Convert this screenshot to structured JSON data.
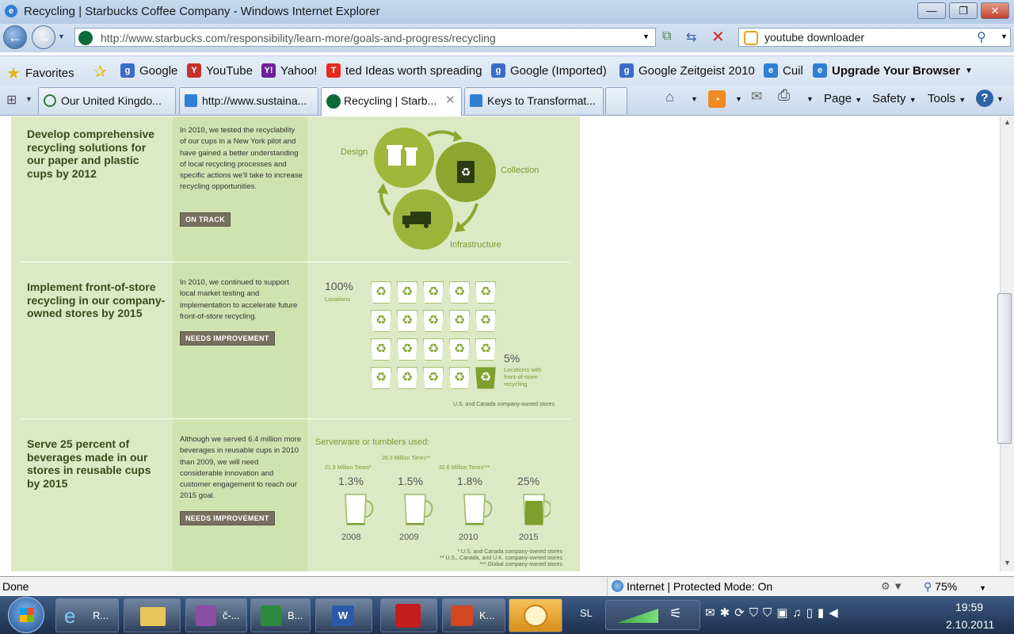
{
  "window": {
    "title": "Recycling | Starbucks Coffee Company - Windows Internet Explorer",
    "controls": {
      "minimize": "—",
      "restore": "❐",
      "close": "✕"
    }
  },
  "nav": {
    "back": "←",
    "forward": "→",
    "url": "http://www.starbucks.com/responsibility/learn-more/goals-and-progress/recycling",
    "search_value": "youtube downloader"
  },
  "favorites": {
    "label": "Favorites",
    "items": [
      "Google",
      "YouTube",
      "Yahoo!",
      "ted Ideas worth spreading",
      "Google (Imported)",
      "Google Zeitgeist 2010",
      "Cuil",
      "Upgrade Your Browser"
    ]
  },
  "tabs": [
    {
      "label": "Our United Kingdo..."
    },
    {
      "label": "http://www.sustaina..."
    },
    {
      "label": "Recycling | Starb..."
    },
    {
      "label": "Keys to Transformat..."
    }
  ],
  "tools": {
    "page": "Page",
    "safety": "Safety",
    "tools": "Tools",
    "help": "?"
  },
  "goals": [
    {
      "title": "Develop comprehensive recycling solutions for our paper and plastic cups by 2012",
      "description": "In 2010, we tested the recyclability of our cups in a New York pilot and have gained a better understanding of local recycling processes and specific actions we'll take to increase recycling opportunities.",
      "status": "ON TRACK"
    },
    {
      "title": "Implement front-of-store recycling in our company-owned stores by 2015",
      "description": "In 2010, we continued to support local market testing and implementation to accelerate future front-of-store recycling.",
      "status": "NEEDS IMPROVEMENT"
    },
    {
      "title": "Serve 25 percent of beverages made in our stores in reusable cups by 2015",
      "description": "Although we served 6.4 million more beverages in reusable cups in 2010 than 2009, we will need considerable innovation and customer engagement to reach our 2015 goal.",
      "status": "NEEDS IMPROVEMENT"
    }
  ],
  "cycle": {
    "design": "Design",
    "collection": "Collection",
    "infrastructure": "Infrastructure"
  },
  "stores": {
    "total_pct": "100%",
    "total_label": "Locations",
    "recycle_pct": "5%",
    "recycle_label": "Locations with front-of-store recycling",
    "footnote": "U.S. and Canada company-owned stores",
    "total_icons": 20,
    "green_icons": 1
  },
  "serveware": {
    "heading": "Serverware or tumblers used:",
    "years": [
      {
        "year": "2008",
        "pct": "1.3%",
        "times": "21.9 Million Times*",
        "fill": 0.013
      },
      {
        "year": "2009",
        "pct": "1.5%",
        "times": "26.3 Million Times**",
        "fill": 0.015
      },
      {
        "year": "2010",
        "pct": "1.8%",
        "times": "32.6 Million Times***",
        "fill": 0.018
      },
      {
        "year": "2015",
        "pct": "25%",
        "times": "",
        "fill": 0.25
      }
    ],
    "notes": [
      "* U.S. and Canada company-owned stores",
      "** U.S., Canada, and U.K. company-owned stores",
      "*** Global company-owned stores"
    ]
  },
  "status": {
    "left": "Done",
    "zone": "Internet | Protected Mode: On",
    "zoom": "75%"
  },
  "taskbar": {
    "items": [
      "R...",
      "",
      "č-...",
      "B...",
      "",
      "",
      "K...",
      ""
    ],
    "lang": "SL",
    "time": "19:59",
    "date": "2.10.2011"
  }
}
